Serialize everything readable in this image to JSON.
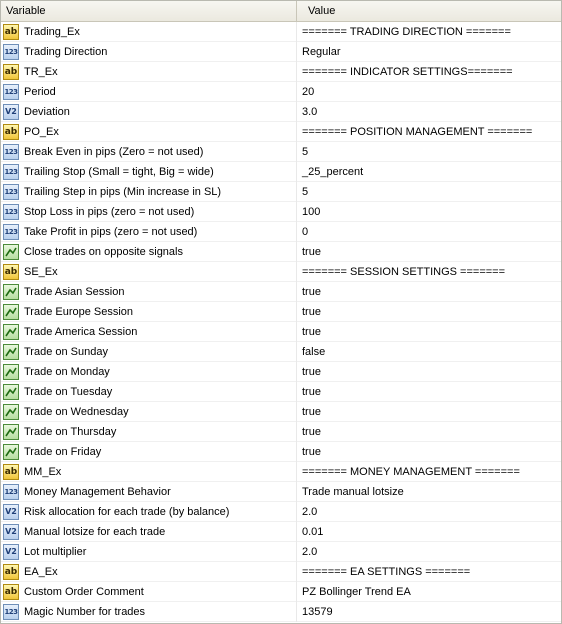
{
  "header": {
    "variable": "Variable",
    "value": "Value"
  },
  "rows": [
    {
      "icon": "string-icon",
      "name": "Trading_Ex",
      "value": "======= TRADING DIRECTION ======="
    },
    {
      "icon": "integer-icon",
      "name": "Trading Direction",
      "value": "Regular"
    },
    {
      "icon": "string-icon",
      "name": "TR_Ex",
      "value": "======= INDICATOR SETTINGS======="
    },
    {
      "icon": "integer-icon",
      "name": "Period",
      "value": "20"
    },
    {
      "icon": "double-icon",
      "name": "Deviation",
      "value": "3.0"
    },
    {
      "icon": "string-icon",
      "name": "PO_Ex",
      "value": "======= POSITION MANAGEMENT ======="
    },
    {
      "icon": "integer-icon",
      "name": "Break Even in pips (Zero = not used)",
      "value": "5"
    },
    {
      "icon": "integer-icon",
      "name": "Trailing Stop (Small = tight, Big = wide)",
      "value": "_25_percent"
    },
    {
      "icon": "integer-icon",
      "name": "Trailing Step in pips (Min increase in SL)",
      "value": "5"
    },
    {
      "icon": "integer-icon",
      "name": "Stop Loss in pips (zero = not used)",
      "value": "100"
    },
    {
      "icon": "integer-icon",
      "name": "Take Profit in pips (zero = not used)",
      "value": "0"
    },
    {
      "icon": "bool-icon",
      "name": "Close trades on opposite signals",
      "value": "true"
    },
    {
      "icon": "string-icon",
      "name": "SE_Ex",
      "value": "======= SESSION SETTINGS ======="
    },
    {
      "icon": "bool-icon",
      "name": "Trade Asian Session",
      "value": "true"
    },
    {
      "icon": "bool-icon",
      "name": "Trade Europe Session",
      "value": "true"
    },
    {
      "icon": "bool-icon",
      "name": "Trade America Session",
      "value": "true"
    },
    {
      "icon": "bool-icon",
      "name": "Trade on Sunday",
      "value": "false"
    },
    {
      "icon": "bool-icon",
      "name": "Trade on Monday",
      "value": "true"
    },
    {
      "icon": "bool-icon",
      "name": "Trade on Tuesday",
      "value": "true"
    },
    {
      "icon": "bool-icon",
      "name": "Trade on Wednesday",
      "value": "true"
    },
    {
      "icon": "bool-icon",
      "name": "Trade on Thursday",
      "value": "true"
    },
    {
      "icon": "bool-icon",
      "name": "Trade on Friday",
      "value": "true"
    },
    {
      "icon": "string-icon",
      "name": "MM_Ex",
      "value": "======= MONEY MANAGEMENT ======="
    },
    {
      "icon": "integer-icon",
      "name": "Money Management Behavior",
      "value": "Trade manual lotsize"
    },
    {
      "icon": "double-icon",
      "name": "Risk allocation for each trade (by balance)",
      "value": "2.0"
    },
    {
      "icon": "double-icon",
      "name": "Manual lotsize for each trade",
      "value": "0.01"
    },
    {
      "icon": "double-icon",
      "name": "Lot multiplier",
      "value": "2.0"
    },
    {
      "icon": "string-icon",
      "name": "EA_Ex",
      "value": "======= EA SETTINGS ======="
    },
    {
      "icon": "string-icon",
      "name": "Custom Order Comment",
      "value": "PZ Bollinger Trend EA"
    },
    {
      "icon": "integer-icon",
      "name": "Magic Number for trades",
      "value": "13579"
    }
  ]
}
